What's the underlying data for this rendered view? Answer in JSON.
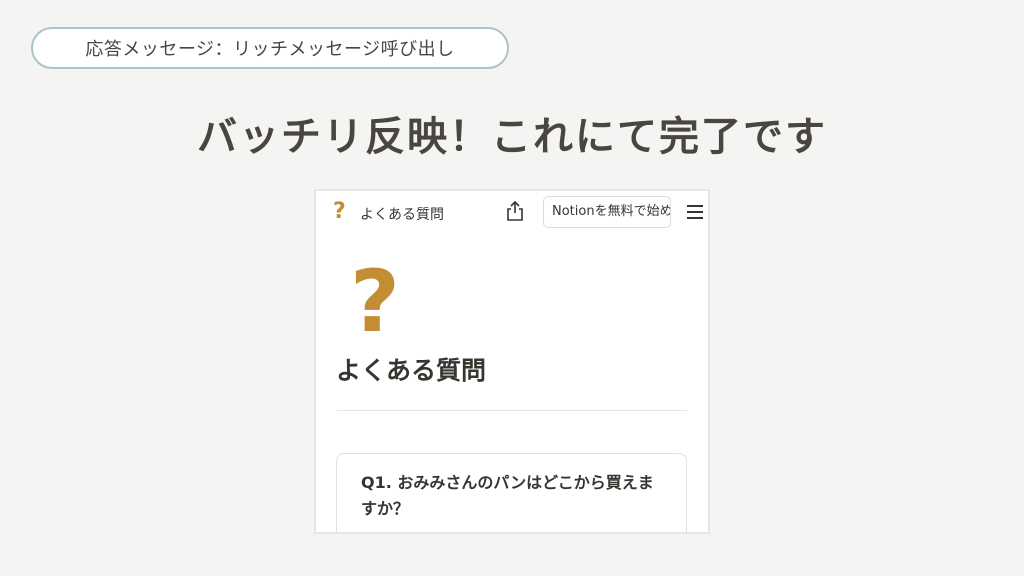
{
  "slide": {
    "tag_label": "応答メッセージ：リッチメッセージ呼び出し",
    "headline": "バッチリ反映！これにて完了です"
  },
  "notion_page": {
    "topbar": {
      "icon": "?",
      "title": "よくある質問",
      "share_icon": "share-icon",
      "cta_button": "Notionを無料で始め",
      "menu_icon": "hamburger-menu-icon"
    },
    "page_icon": "?",
    "page_title": "よくある質問",
    "faq_items": [
      {
        "question": "Q1. おみみさんのパンはどこから買えますか？"
      }
    ]
  },
  "colors": {
    "background": "#f4f4f3",
    "pill_border": "#a9c4cb",
    "accent_question": "#c38d33",
    "text_dark": "#4a4541"
  }
}
